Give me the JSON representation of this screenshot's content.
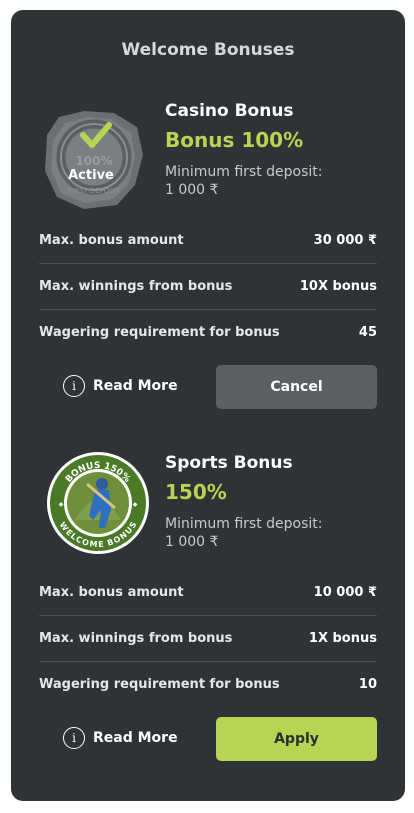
{
  "title": "Welcome Bonuses",
  "bonuses": [
    {
      "title": "Casino Bonus",
      "value": "Bonus 100%",
      "badge_percent": "100%",
      "badge_status": "Active",
      "badge_arc_text": "FIRST DEPOSIT",
      "min_label": "Minimum first deposit:",
      "min_value": "1 000 ₹",
      "rows": [
        {
          "label": "Max. bonus amount",
          "value": "30 000 ₹"
        },
        {
          "label": "Max. winnings from bonus",
          "value": "10X bonus"
        },
        {
          "label": "Wagering requirement for bonus",
          "value": "45"
        }
      ],
      "read_more": "Read More",
      "action": "Cancel"
    },
    {
      "title": "Sports Bonus",
      "value": "150%",
      "badge_top": "BONUS 150%",
      "badge_bottom": "WELCOME BONUS",
      "min_label": "Minimum first deposit:",
      "min_value": "1 000 ₹",
      "rows": [
        {
          "label": "Max. bonus amount",
          "value": "10 000 ₹"
        },
        {
          "label": "Max. winnings from bonus",
          "value": "1X bonus"
        },
        {
          "label": "Wagering requirement for bonus",
          "value": "10"
        }
      ],
      "read_more": "Read More",
      "action": "Apply"
    }
  ],
  "colors": {
    "accent": "#b8d453",
    "background": "#2f3336",
    "cancel": "#5b6065"
  }
}
